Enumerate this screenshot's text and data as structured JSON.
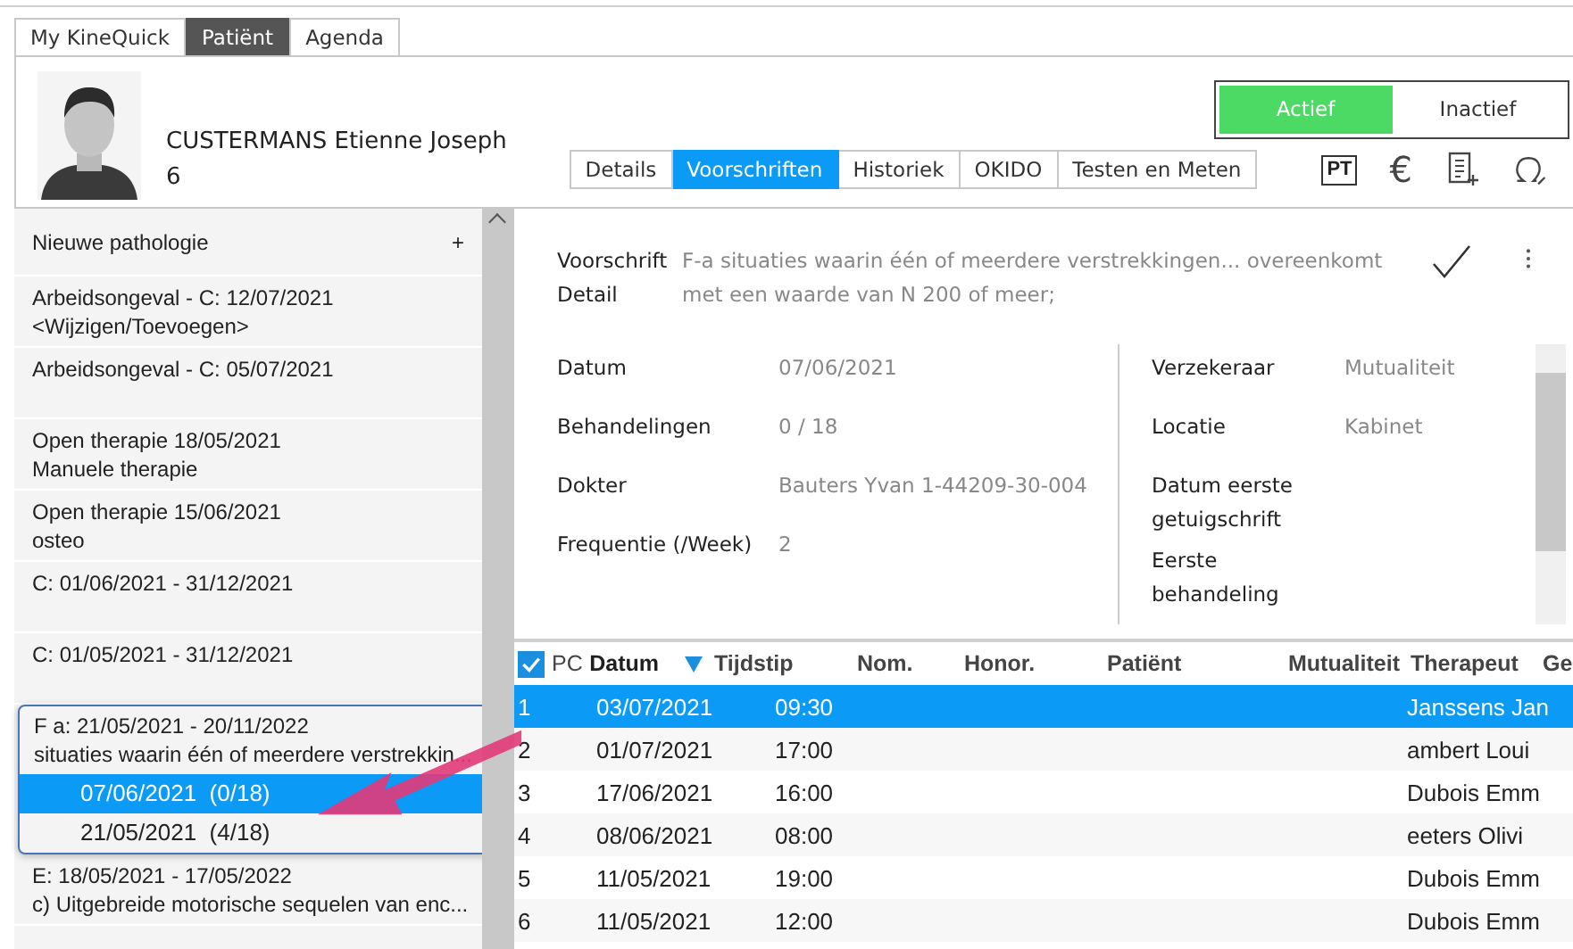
{
  "top_tabs": [
    {
      "label": "My KineQuick",
      "selected": false
    },
    {
      "label": "Patiënt",
      "selected": true
    },
    {
      "label": "Agenda",
      "selected": false
    }
  ],
  "patient": {
    "name": "CUSTERMANS Etienne Joseph",
    "number": "6"
  },
  "status_toggle": [
    {
      "label": "Actief",
      "selected": true
    },
    {
      "label": "Inactief",
      "selected": false
    }
  ],
  "detail_tabs": [
    {
      "label": "Details",
      "selected": false
    },
    {
      "label": "Voorschriften",
      "selected": true
    },
    {
      "label": "Historiek",
      "selected": false
    },
    {
      "label": "OKIDO",
      "selected": false
    },
    {
      "label": "Testen en Meten",
      "selected": false
    }
  ],
  "toolbar": {
    "pt_badge": "PT",
    "euro": "€"
  },
  "sidebar": {
    "new_item": {
      "label": "Nieuwe pathologie",
      "action": "+"
    },
    "items": [
      {
        "kind": "item",
        "lines": [
          "Arbeidsongeval - C: 12/07/2021",
          "<Wijzigen/Toevoegen>"
        ]
      },
      {
        "kind": "item",
        "lines": [
          "Arbeidsongeval - C: 05/07/2021"
        ]
      },
      {
        "kind": "item",
        "lines": [
          "Open therapie 18/05/2021",
          "Manuele therapie"
        ]
      },
      {
        "kind": "item",
        "lines": [
          "Open therapie 15/06/2021",
          "osteo"
        ]
      },
      {
        "kind": "item",
        "lines": [
          "C: 01/06/2021 - 31/12/2021"
        ]
      },
      {
        "kind": "item",
        "lines": [
          "C: 01/05/2021 - 31/12/2021"
        ]
      },
      {
        "kind": "group",
        "highlighted": true,
        "lines": [
          "F a: 21/05/2021 - 20/11/2022",
          "situaties waarin één of meerdere verstrekkin..."
        ],
        "children": [
          {
            "label": "07/06/2021  (0/18)",
            "selected": true
          },
          {
            "label": "21/05/2021  (4/18)",
            "selected": false
          }
        ]
      },
      {
        "kind": "item",
        "lines": [
          "E: 18/05/2021 - 17/05/2022",
          "c) Uitgebreide motorische sequelen van enc..."
        ]
      }
    ]
  },
  "prescription": {
    "label": "Voorschrift Detail",
    "text": "F-a situaties waarin één of meerdere verstrekkingen... overeenkomt met een waarde van N 200 of meer;"
  },
  "fields_left": [
    {
      "label": "Datum",
      "value": "07/06/2021"
    },
    {
      "label": "Behandelingen",
      "value": "0 / 18"
    },
    {
      "label": "Dokter",
      "value": "Bauters Yvan 1-44209-30-004"
    },
    {
      "label": "Frequentie (/Week)",
      "value": "2"
    }
  ],
  "fields_right": [
    {
      "label": "Verzekeraar",
      "value": "Mutualiteit"
    },
    {
      "label": "Locatie",
      "value": "Kabinet"
    },
    {
      "label": "Datum eerste getuigschrift"
    },
    {
      "label": "Eerste behandeling"
    }
  ],
  "table": {
    "select_all_checked": true,
    "columns": [
      {
        "label": "PC",
        "sorted": false
      },
      {
        "label": "Datum",
        "sorted": true
      },
      {
        "label": "Tijdstip",
        "sorted": false
      },
      {
        "label": "Nom.",
        "sorted": false
      },
      {
        "label": "Honor.",
        "sorted": false
      },
      {
        "label": "Patiënt",
        "sorted": false
      },
      {
        "label": "Mutualiteit",
        "sorted": false
      },
      {
        "label": "Therapeut",
        "sorted": false
      },
      {
        "label": "Ge",
        "sorted": false
      }
    ],
    "rows": [
      {
        "selected": true,
        "cells": [
          "1",
          "03/07/2021",
          "09:30",
          "Janssens Jan"
        ]
      },
      {
        "selected": false,
        "cells": [
          "2",
          "01/07/2021",
          "17:00",
          "ambert Loui"
        ]
      },
      {
        "selected": false,
        "cells": [
          "3",
          "17/06/2021",
          "16:00",
          "Dubois Emm"
        ]
      },
      {
        "selected": false,
        "cells": [
          "4",
          "08/06/2021",
          "08:00",
          "eeters Olivi"
        ]
      },
      {
        "selected": false,
        "cells": [
          "5",
          "11/05/2021",
          "19:00",
          "Dubois Emm"
        ]
      },
      {
        "selected": false,
        "cells": [
          "6",
          "11/05/2021",
          "12:00",
          "Dubois Emm"
        ]
      }
    ]
  }
}
